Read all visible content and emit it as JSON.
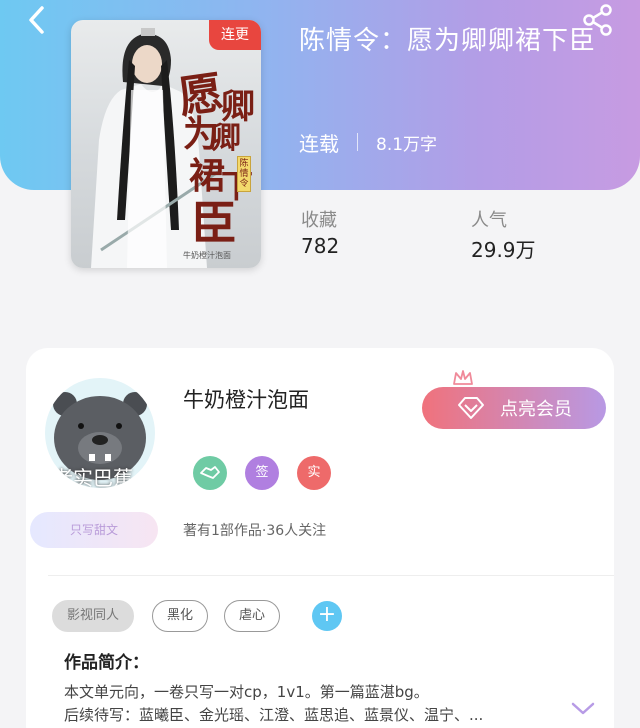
{
  "book": {
    "title": "陈情令：愿为卿卿裙下臣",
    "status": "连载",
    "word_count": "8.1万字",
    "cover": {
      "badge": "连更",
      "title_chars": [
        "愿",
        "为",
        "卿",
        "卿",
        "裙",
        "下",
        "臣"
      ],
      "side_label": "陈情令",
      "author": "牛奶橙汁泡面"
    }
  },
  "stats": {
    "favorites_label": "收藏",
    "favorites_value": "782",
    "popularity_label": "人气",
    "popularity_value": "29.9万"
  },
  "author": {
    "name": "牛奶橙汁泡面",
    "avatar_text": "老实巴蕉",
    "avatar_tag": "只写甜文",
    "vip_button": "点亮会员",
    "badges": [
      {
        "label": "",
        "icon": "handshake-icon",
        "color": "#6fcba4"
      },
      {
        "label": "签",
        "icon": "",
        "color": "#b07fe0"
      },
      {
        "label": "实",
        "icon": "",
        "color": "#ee6a6a"
      }
    ],
    "stats_text": "著有1部作品·36人关注"
  },
  "tags": [
    "影视同人",
    "黑化",
    "虐心"
  ],
  "intro": {
    "title": "作品简介：",
    "line1": "本文单元向，一卷只写一对cp，1v1。第一篇蓝湛bg。",
    "line2": "后续待写：蓝曦臣、金光瑶、江澄、蓝思追、蓝景仪、温宁、..."
  },
  "colors": {
    "header_start": "#6ec9f2",
    "header_end": "#c79be2",
    "vip_start": "#f0727c",
    "vip_end": "#b899e4",
    "add_tag": "#5fc7f3"
  }
}
